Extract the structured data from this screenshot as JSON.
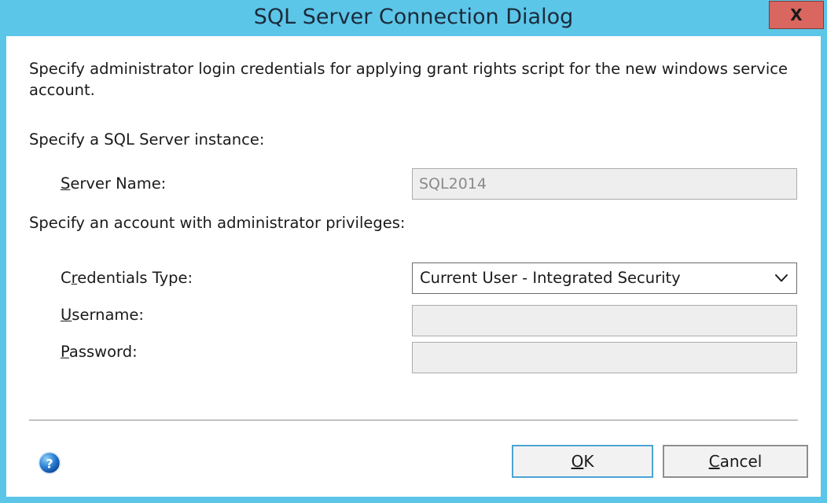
{
  "window": {
    "title": "SQL Server Connection Dialog",
    "close_label": "X",
    "titlebar_color": "#5cc6e8",
    "close_button_color": "#d9665f"
  },
  "content": {
    "description": "Specify administrator login credentials for applying grant rights script for the new windows service account.",
    "instance_section_label": "Specify a SQL Server instance:",
    "account_section_label": "Specify an account with administrator privileges:"
  },
  "fields": {
    "server_name": {
      "label_prefix": "",
      "label_accel": "S",
      "label_suffix": "erver Name:",
      "value": "SQL2014",
      "placeholder": "",
      "enabled": false
    },
    "credentials_type": {
      "label_prefix": "C",
      "label_accel": "r",
      "label_suffix": "edentials Type:",
      "selected": "Current User  - Integrated Security",
      "arrow_icon": "chevron-down-icon",
      "enabled": true
    },
    "username": {
      "label_prefix": "",
      "label_accel": "U",
      "label_suffix": "sername:",
      "value": "",
      "placeholder": "",
      "enabled": false
    },
    "password": {
      "label_prefix": "",
      "label_accel": "P",
      "label_suffix": "assword:",
      "value": "",
      "placeholder": "",
      "enabled": false
    }
  },
  "footer": {
    "help_icon": "help-circle-icon",
    "ok": {
      "prefix": "",
      "accel": "O",
      "suffix": "K",
      "is_default": true,
      "focus_color": "#4ba3d3"
    },
    "cancel": {
      "prefix": "",
      "accel": "C",
      "suffix": "ancel",
      "is_default": false
    }
  }
}
